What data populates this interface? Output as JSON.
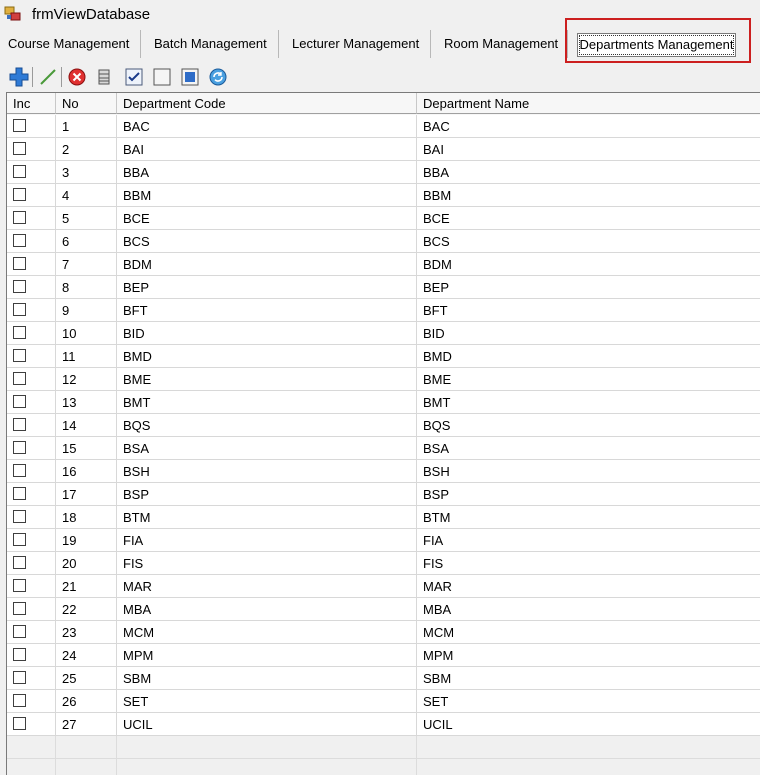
{
  "window": {
    "title": "frmViewDatabase",
    "icon": "app-window-icon"
  },
  "tabs": [
    {
      "label": "Course Management"
    },
    {
      "label": "Batch Management"
    },
    {
      "label": "Lecturer Management"
    },
    {
      "label": "Room Management"
    },
    {
      "label": "Departments Management",
      "selected": true
    }
  ],
  "toolbar": {
    "icons": [
      "add-icon",
      "edit-icon",
      "delete-icon",
      "database-icon",
      "check-all-icon",
      "uncheck-all-icon",
      "select-icon",
      "refresh-icon"
    ]
  },
  "grid": {
    "columns": [
      "Inc",
      "No",
      "Department Code",
      "Department Name"
    ],
    "rows": [
      {
        "no": "1",
        "code": "BAC",
        "name": "BAC"
      },
      {
        "no": "2",
        "code": "BAI",
        "name": "BAI"
      },
      {
        "no": "3",
        "code": "BBA",
        "name": "BBA"
      },
      {
        "no": "4",
        "code": "BBM",
        "name": "BBM"
      },
      {
        "no": "5",
        "code": "BCE",
        "name": "BCE"
      },
      {
        "no": "6",
        "code": "BCS",
        "name": "BCS"
      },
      {
        "no": "7",
        "code": "BDM",
        "name": "BDM"
      },
      {
        "no": "8",
        "code": "BEP",
        "name": "BEP"
      },
      {
        "no": "9",
        "code": "BFT",
        "name": "BFT"
      },
      {
        "no": "10",
        "code": "BID",
        "name": "BID"
      },
      {
        "no": "11",
        "code": "BMD",
        "name": "BMD"
      },
      {
        "no": "12",
        "code": "BME",
        "name": "BME"
      },
      {
        "no": "13",
        "code": "BMT",
        "name": "BMT"
      },
      {
        "no": "14",
        "code": "BQS",
        "name": "BQS"
      },
      {
        "no": "15",
        "code": "BSA",
        "name": "BSA"
      },
      {
        "no": "16",
        "code": "BSH",
        "name": "BSH"
      },
      {
        "no": "17",
        "code": "BSP",
        "name": "BSP"
      },
      {
        "no": "18",
        "code": "BTM",
        "name": "BTM"
      },
      {
        "no": "19",
        "code": "FIA",
        "name": "FIA"
      },
      {
        "no": "20",
        "code": "FIS",
        "name": "FIS"
      },
      {
        "no": "21",
        "code": "MAR",
        "name": "MAR"
      },
      {
        "no": "22",
        "code": "MBA",
        "name": "MBA"
      },
      {
        "no": "23",
        "code": "MCM",
        "name": "MCM"
      },
      {
        "no": "24",
        "code": "MPM",
        "name": "MPM"
      },
      {
        "no": "25",
        "code": "SBM",
        "name": "SBM"
      },
      {
        "no": "26",
        "code": "SET",
        "name": "SET"
      },
      {
        "no": "27",
        "code": "UCIL",
        "name": "UCIL"
      }
    ]
  },
  "colors": {
    "highlight": "#cc1f1f",
    "grid_bg": "#ffffff",
    "window_bg": "#f0f0f0"
  }
}
